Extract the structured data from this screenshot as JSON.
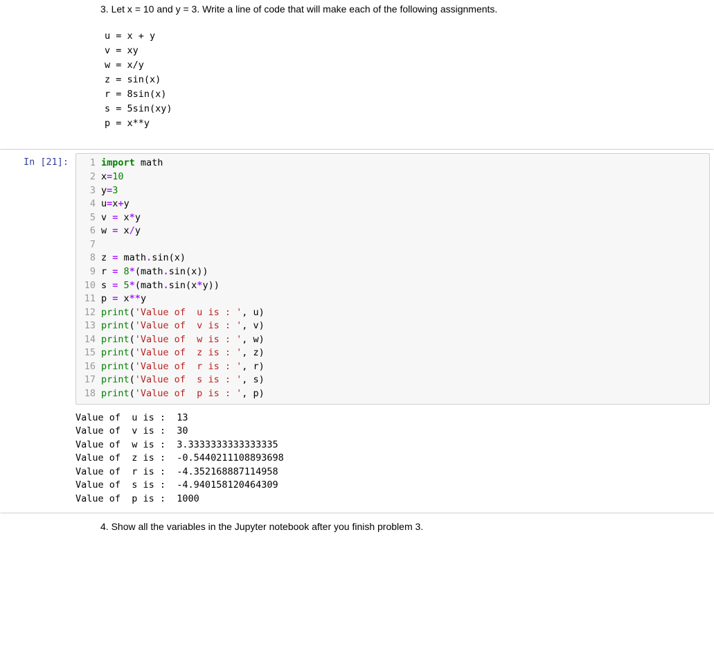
{
  "question3": {
    "number": "3.",
    "text": "Let x = 10 and y = 3. Write a line of code that will make each of the following assignments.",
    "equations": [
      "u = x + y",
      "v = xy",
      "w = x/y",
      "z = sin(x)",
      "r = 8sin(x)",
      "s = 5sin(xy)",
      "p = x**y"
    ]
  },
  "code_cell": {
    "prompt_label": "In [21]:",
    "lines": [
      {
        "n": 1,
        "tokens": [
          [
            "kw",
            "import"
          ],
          [
            "sp",
            " "
          ],
          [
            "nm",
            "math"
          ]
        ]
      },
      {
        "n": 2,
        "tokens": [
          [
            "nm",
            "x"
          ],
          [
            "op",
            "="
          ],
          [
            "num",
            "10"
          ]
        ]
      },
      {
        "n": 3,
        "tokens": [
          [
            "nm",
            "y"
          ],
          [
            "op",
            "="
          ],
          [
            "num",
            "3"
          ]
        ]
      },
      {
        "n": 4,
        "tokens": [
          [
            "nm",
            "u"
          ],
          [
            "op",
            "="
          ],
          [
            "nm",
            "x"
          ],
          [
            "op",
            "+"
          ],
          [
            "nm",
            "y"
          ]
        ]
      },
      {
        "n": 5,
        "tokens": [
          [
            "nm",
            "v "
          ],
          [
            "op",
            "="
          ],
          [
            "nm",
            " x"
          ],
          [
            "op",
            "*"
          ],
          [
            "nm",
            "y"
          ]
        ]
      },
      {
        "n": 6,
        "tokens": [
          [
            "nm",
            "w "
          ],
          [
            "op",
            "="
          ],
          [
            "nm",
            " x"
          ],
          [
            "op",
            "/"
          ],
          [
            "nm",
            "y"
          ]
        ]
      },
      {
        "n": 7,
        "tokens": []
      },
      {
        "n": 8,
        "tokens": [
          [
            "nm",
            "z "
          ],
          [
            "op",
            "="
          ],
          [
            "nm",
            " math"
          ],
          [
            "op",
            "."
          ],
          [
            "nm",
            "sin"
          ],
          [
            "p",
            "("
          ],
          [
            "nm",
            "x"
          ],
          [
            "p",
            ")"
          ]
        ]
      },
      {
        "n": 9,
        "tokens": [
          [
            "nm",
            "r "
          ],
          [
            "op",
            "="
          ],
          [
            "nm",
            " "
          ],
          [
            "num",
            "8"
          ],
          [
            "op",
            "*"
          ],
          [
            "p",
            "("
          ],
          [
            "nm",
            "math"
          ],
          [
            "op",
            "."
          ],
          [
            "nm",
            "sin"
          ],
          [
            "p",
            "("
          ],
          [
            "nm",
            "x"
          ],
          [
            "p",
            "))"
          ]
        ]
      },
      {
        "n": 10,
        "tokens": [
          [
            "nm",
            "s "
          ],
          [
            "op",
            "="
          ],
          [
            "nm",
            " "
          ],
          [
            "num",
            "5"
          ],
          [
            "op",
            "*"
          ],
          [
            "p",
            "("
          ],
          [
            "nm",
            "math"
          ],
          [
            "op",
            "."
          ],
          [
            "nm",
            "sin"
          ],
          [
            "p",
            "("
          ],
          [
            "nm",
            "x"
          ],
          [
            "op",
            "*"
          ],
          [
            "nm",
            "y"
          ],
          [
            "p",
            "))"
          ]
        ]
      },
      {
        "n": 11,
        "tokens": [
          [
            "nm",
            "p "
          ],
          [
            "op",
            "="
          ],
          [
            "nm",
            " x"
          ],
          [
            "op",
            "**"
          ],
          [
            "nm",
            "y"
          ]
        ]
      },
      {
        "n": 12,
        "tokens": [
          [
            "builtin",
            "print"
          ],
          [
            "p",
            "("
          ],
          [
            "str",
            "'Value of  u is : '"
          ],
          [
            "p",
            ", u)"
          ]
        ]
      },
      {
        "n": 13,
        "tokens": [
          [
            "builtin",
            "print"
          ],
          [
            "p",
            "("
          ],
          [
            "str",
            "'Value of  v is : '"
          ],
          [
            "p",
            ", v)"
          ]
        ]
      },
      {
        "n": 14,
        "tokens": [
          [
            "builtin",
            "print"
          ],
          [
            "p",
            "("
          ],
          [
            "str",
            "'Value of  w is : '"
          ],
          [
            "p",
            ", w)"
          ]
        ]
      },
      {
        "n": 15,
        "tokens": [
          [
            "builtin",
            "print"
          ],
          [
            "p",
            "("
          ],
          [
            "str",
            "'Value of  z is : '"
          ],
          [
            "p",
            ", z)"
          ]
        ]
      },
      {
        "n": 16,
        "tokens": [
          [
            "builtin",
            "print"
          ],
          [
            "p",
            "("
          ],
          [
            "str",
            "'Value of  r is : '"
          ],
          [
            "p",
            ", r)"
          ]
        ]
      },
      {
        "n": 17,
        "tokens": [
          [
            "builtin",
            "print"
          ],
          [
            "p",
            "("
          ],
          [
            "str",
            "'Value of  s is : '"
          ],
          [
            "p",
            ", s)"
          ]
        ]
      },
      {
        "n": 18,
        "tokens": [
          [
            "builtin",
            "print"
          ],
          [
            "p",
            "("
          ],
          [
            "str",
            "'Value of  p is : '"
          ],
          [
            "p",
            ", p)"
          ]
        ]
      }
    ],
    "output": "Value of  u is :  13\nValue of  v is :  30\nValue of  w is :  3.3333333333333335\nValue of  z is :  -0.5440211108893698\nValue of  r is :  -4.352168887114958\nValue of  s is :  -4.940158120464309\nValue of  p is :  1000"
  },
  "question4": {
    "number": "4.",
    "text": "Show all the variables in the Jupyter notebook after you finish problem 3."
  }
}
